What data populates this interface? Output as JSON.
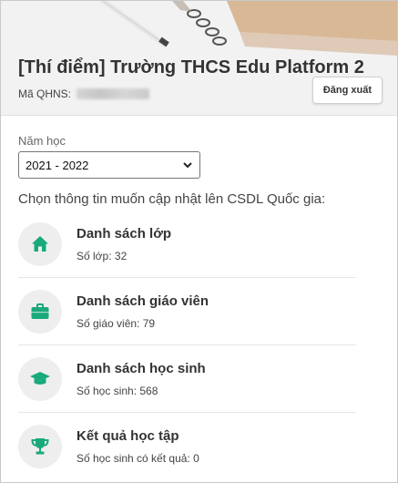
{
  "header": {
    "title": "[Thí điểm] Trường THCS Edu Platform 2",
    "qhns_label": "Mã QHNS:",
    "logout_label": "Đăng xuất"
  },
  "filter": {
    "year_label": "Năm học",
    "year_value": "2021 - 2022"
  },
  "prompt": "Chọn thông tin muốn cập nhật lên CSDL Quốc gia:",
  "items": [
    {
      "icon": "home-icon",
      "title": "Danh sách lớp",
      "sub": "Số lớp: 32"
    },
    {
      "icon": "briefcase-icon",
      "title": "Danh sách giáo viên",
      "sub": "Số giáo viên: 79"
    },
    {
      "icon": "graduation-cap-icon",
      "title": "Danh sách học sinh",
      "sub": "Số học sinh: 568"
    },
    {
      "icon": "trophy-icon",
      "title": "Kết quả học tập",
      "sub": "Số học sinh có kết quả: 0"
    }
  ],
  "colors": {
    "accent": "#1aa97c",
    "icon_bg": "#eeeeee"
  }
}
